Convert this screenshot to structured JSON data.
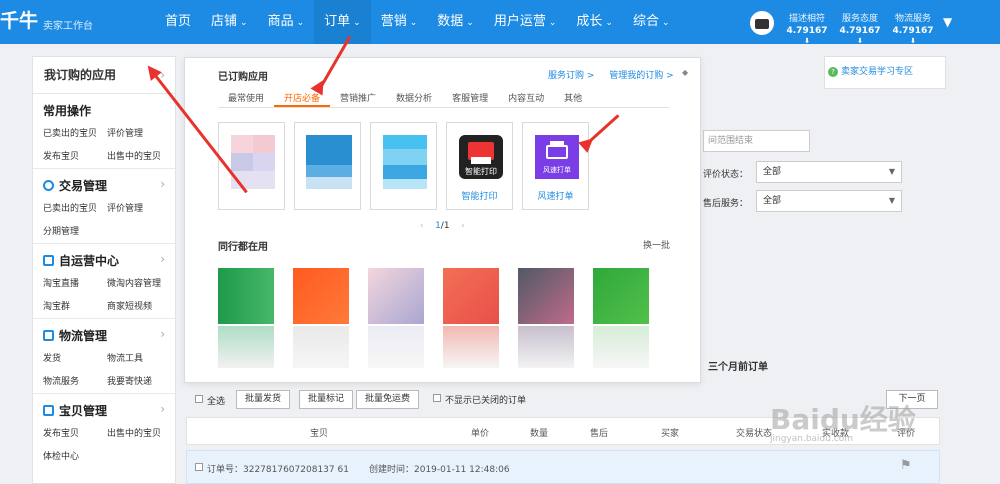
{
  "header": {
    "logo": "千牛",
    "subtitle": "卖家工作台",
    "nav": [
      "首页",
      "店铺",
      "商品",
      "订单",
      "营销",
      "数据",
      "用户运营",
      "成长",
      "综合"
    ],
    "metrics": [
      {
        "label": "描述相符",
        "value": "4.79167"
      },
      {
        "label": "服务态度",
        "value": "4.79167"
      },
      {
        "label": "物流服务",
        "value": "4.79167"
      }
    ]
  },
  "sidebar": {
    "title": "我订购的应用",
    "sections": [
      {
        "title": "常用操作",
        "items": [
          "已卖出的宝贝",
          "评价管理",
          "发布宝贝",
          "出售中的宝贝"
        ]
      },
      {
        "title": "交易管理",
        "items": [
          "已卖出的宝贝",
          "评价管理",
          "分期管理"
        ]
      },
      {
        "title": "自运营中心",
        "items": [
          "淘宝直播",
          "微淘内容管理",
          "淘宝群",
          "商家短视频"
        ]
      },
      {
        "title": "物流管理",
        "items": [
          "发货",
          "物流工具",
          "物流服务",
          "我要寄快递"
        ]
      },
      {
        "title": "宝贝管理",
        "items": [
          "发布宝贝",
          "出售中的宝贝",
          "体检中心"
        ]
      }
    ]
  },
  "popup": {
    "title": "已订购应用",
    "links": [
      "服务订购 >",
      "管理我的订购 >"
    ],
    "tabs": [
      "最常使用",
      "开店必备",
      "营销推广",
      "数据分析",
      "客服管理",
      "内容互动",
      "其他"
    ],
    "active_tab": "开店必备",
    "apps": [
      "",
      "",
      "",
      "智能打印",
      "风速打单"
    ],
    "pagination": {
      "current": "1",
      "total": "/1"
    },
    "peer_title": "同行都在用",
    "refresh": "换一批"
  },
  "main": {
    "help_link": "卖家交易学习专区",
    "date_end_placeholder": "间范围结束",
    "filters": [
      {
        "label": "评价状态：",
        "value": "全部"
      },
      {
        "label": "售后服务：",
        "value": "全部"
      }
    ],
    "order_tab": "三个月前订单",
    "toolbar": {
      "select_all": "全选",
      "buttons": [
        "批量发货",
        "批量标记",
        "批量免运费"
      ],
      "hide_closed": "不显示已关闭的订单",
      "next_page": "下一页"
    },
    "table_headers": [
      "宝贝",
      "单价",
      "数量",
      "售后",
      "买家",
      "交易状态",
      "实收款",
      "评价"
    ],
    "order": {
      "number": "订单号：3227817607208137 61",
      "created": "创建时间：2019-01-11 12:48:06"
    }
  },
  "watermark": {
    "text": "Baidu经验",
    "url": "jingyan.baidu.com"
  }
}
